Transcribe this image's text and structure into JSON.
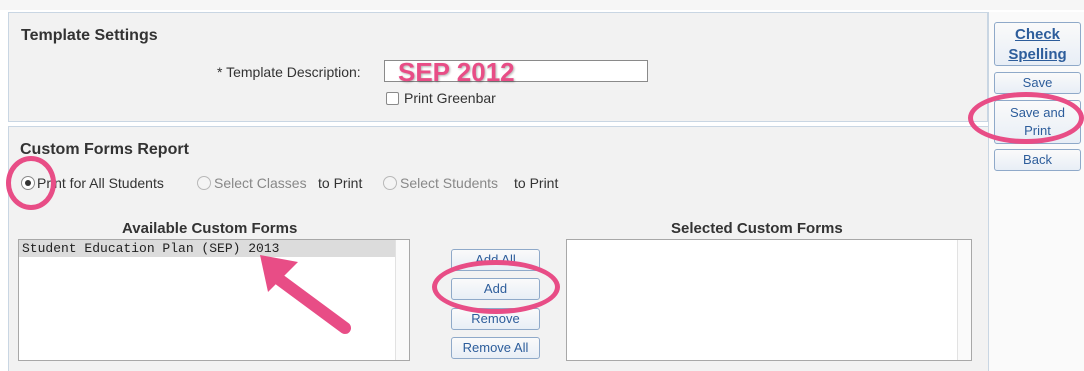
{
  "template_settings": {
    "title": "Template Settings",
    "description_label": "* Template Description:",
    "description_value": "SEP 2012",
    "greenbar_label": "Print Greenbar"
  },
  "custom_forms": {
    "title": "Custom Forms Report",
    "radio_all": "Print for All Students",
    "radio_classes_prefix": "Select Classes",
    "radio_classes_suffix": "to Print",
    "radio_students_prefix": "Select Students",
    "radio_students_suffix": "to Print",
    "available_title": "Available Custom Forms",
    "selected_title": "Selected Custom Forms",
    "available_items": [
      "Student Education Plan (SEP) 2013"
    ],
    "buttons": {
      "add_all": "Add All",
      "add": "Add",
      "remove": "Remove",
      "remove_all": "Remove All"
    }
  },
  "actions": {
    "check_spelling_line1": "Check",
    "check_spelling_line2": "Spelling",
    "save": "Save",
    "save_print_line1": "Save and",
    "save_print_line2": "Print",
    "back": "Back"
  },
  "colors": {
    "highlight": "#e84d86",
    "link_blue": "#2d5d9b"
  }
}
